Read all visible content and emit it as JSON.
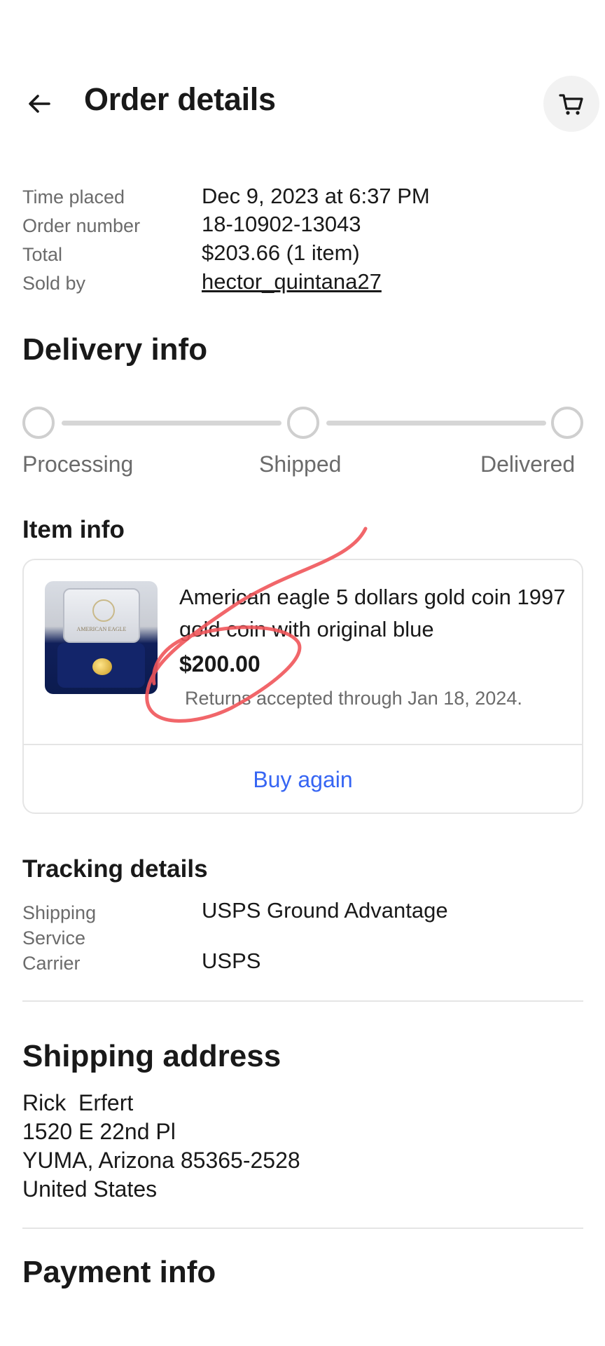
{
  "header": {
    "title": "Order details",
    "back_icon": "arrow-left-icon",
    "cart_icon": "cart-icon"
  },
  "summary": {
    "time_placed_label": "Time placed",
    "time_placed_value": "Dec 9, 2023 at 6:37 PM",
    "order_number_label": "Order number",
    "order_number_value": "18-10902-13043",
    "total_label": "Total",
    "total_value": "$203.66 (1 item)",
    "sold_by_label": "Sold by",
    "sold_by_value": "hector_quintana27"
  },
  "delivery": {
    "title": "Delivery info",
    "steps": [
      "Processing",
      "Shipped",
      "Delivered"
    ]
  },
  "item_info": {
    "title": "Item info",
    "item_title": "American eagle 5 dollars gold coin 1997 gold coin with original blue",
    "price": "$200.00",
    "returns": "Returns accepted through Jan 18, 2024.",
    "image_caption": "AMERICAN EAGLE",
    "buy_again": "Buy again"
  },
  "tracking": {
    "title": "Tracking details",
    "shipping_service_label": "Shipping Service",
    "shipping_service_value": "USPS Ground Advantage",
    "carrier_label": "Carrier",
    "carrier_value": "USPS"
  },
  "shipping_address": {
    "title": "Shipping address",
    "name": "Rick  Erfert",
    "street": "1520 E 22nd Pl",
    "city_line": "YUMA, Arizona 85365-2528",
    "country": "United States"
  },
  "payment": {
    "title": "Payment info"
  },
  "colors": {
    "link_blue": "#3665f3",
    "annotation_red": "#f0555a",
    "muted_text": "#6b6b6b"
  }
}
